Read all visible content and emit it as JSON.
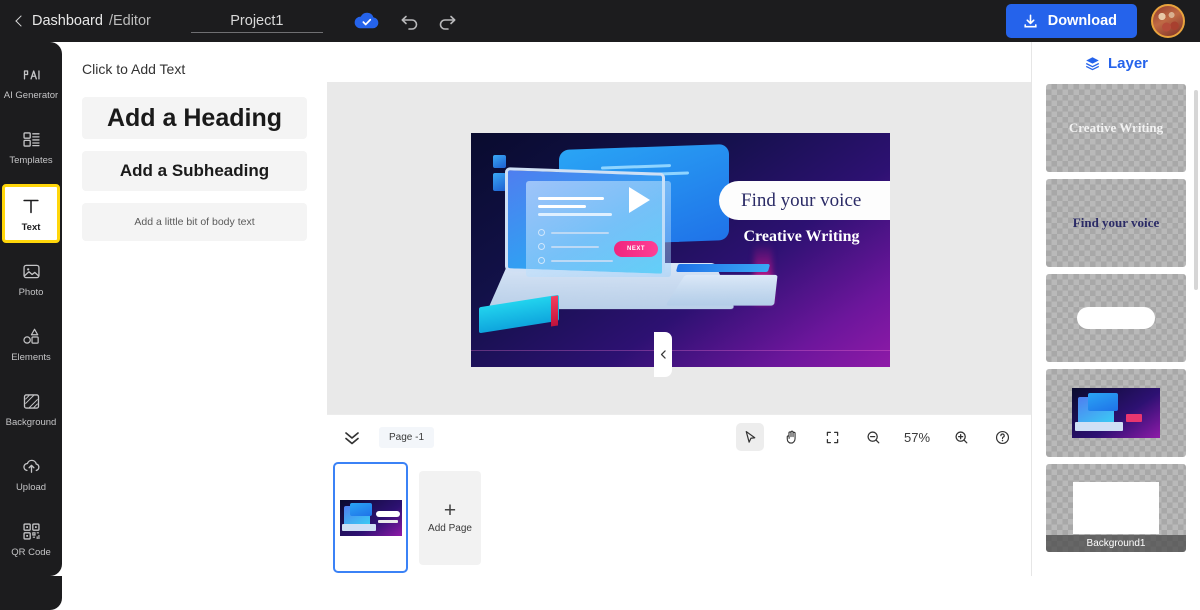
{
  "topbar": {
    "back_label": "Dashboard",
    "back_sub": "/Editor",
    "project_name": "Project1",
    "save_icon": "cloud-check-icon",
    "undo_icon": "undo-icon",
    "redo_icon": "redo-icon",
    "download_label": "Download",
    "download_icon": "download-icon",
    "avatar": "user-avatar",
    "accent_blue": "#2563eb",
    "bar_bg": "#1c1c1e"
  },
  "sidebar": {
    "items": [
      {
        "label": "AI Generator",
        "icon": "ai-generator-icon",
        "active": false
      },
      {
        "label": "Templates",
        "icon": "templates-icon",
        "active": false
      },
      {
        "label": "Text",
        "icon": "text-icon",
        "active": true
      },
      {
        "label": "Photo",
        "icon": "photo-icon",
        "active": false
      },
      {
        "label": "Elements",
        "icon": "elements-icon",
        "active": false
      },
      {
        "label": "Background",
        "icon": "background-icon",
        "active": false
      },
      {
        "label": "Upload",
        "icon": "upload-icon",
        "active": false
      },
      {
        "label": "QR Code",
        "icon": "qr-code-icon",
        "active": false
      }
    ],
    "active_border": "#ffd60a"
  },
  "text_panel": {
    "title": "Click to Add Text",
    "heading_label": "Add a Heading",
    "subheading_label": "Add a Subheading",
    "body_label": "Add a little bit of body text"
  },
  "canvas": {
    "nav_prev_icon": "chevron-left-icon",
    "nav_next_icon": "chevron-right-icon",
    "slide": {
      "headline": "Find your voice",
      "subtitle": "Creative Writing",
      "button_label": "NEXT",
      "headline_color": "#2b2b66",
      "subtitle_color": "#ffffff",
      "bg_from": "#090b2e",
      "bg_to": "#8f1aa8"
    }
  },
  "toolbar": {
    "collapse_icon": "chevron-double-down-icon",
    "page_chip": "Page -1",
    "tools": [
      {
        "name": "select-tool",
        "icon": "cursor-icon",
        "selected": true
      },
      {
        "name": "hand-tool",
        "icon": "hand-icon",
        "selected": false
      },
      {
        "name": "fit-screen-tool",
        "icon": "fullscreen-icon",
        "selected": false
      },
      {
        "name": "zoom-out-tool",
        "icon": "zoom-out-icon",
        "selected": false
      }
    ],
    "zoom_value": "57%",
    "zoom_in_icon": "zoom-in-icon",
    "help_icon": "help-circle-icon"
  },
  "pagestrip": {
    "add_page_label": "Add Page",
    "add_page_icon": "plus-icon",
    "selected_border": "#3b82f6"
  },
  "layers": {
    "title": "Layer",
    "title_icon": "layers-stack-icon",
    "title_color": "#2563eb",
    "items": [
      {
        "name": "layer-text-creative-writing",
        "kind": "text",
        "text": "Creative Writing"
      },
      {
        "name": "layer-text-find-your-voice",
        "kind": "text",
        "text": "Find your voice"
      },
      {
        "name": "layer-shape-white-pill",
        "kind": "shape",
        "text": ""
      },
      {
        "name": "layer-image-laptop",
        "kind": "image",
        "text": ""
      },
      {
        "name": "layer-background1",
        "kind": "bg",
        "text": "Background1"
      }
    ]
  }
}
